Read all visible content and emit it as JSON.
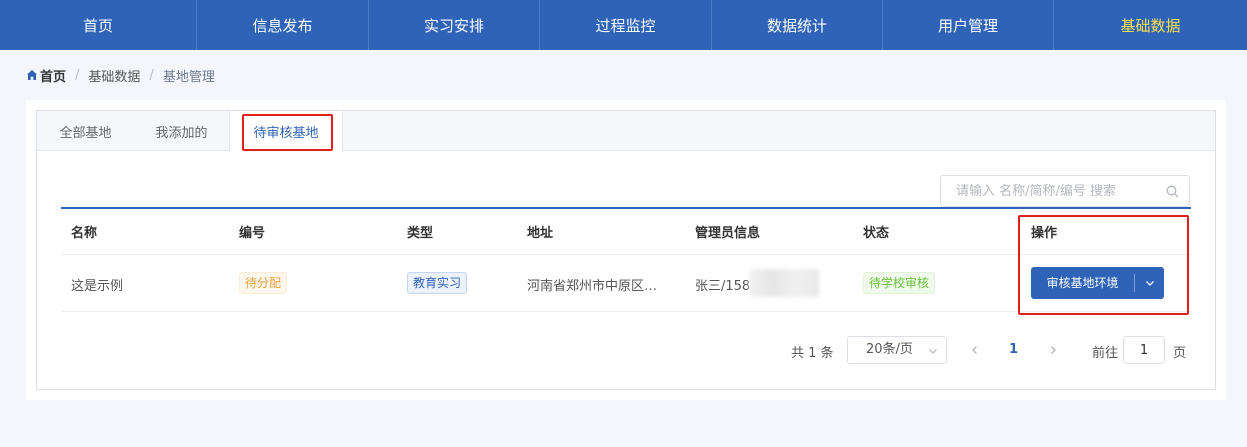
{
  "nav": {
    "items": [
      "首页",
      "信息发布",
      "实习安排",
      "过程监控",
      "数据统计",
      "用户管理",
      "基础数据"
    ],
    "active_index": 6
  },
  "breadcrumb": {
    "home": "首页",
    "middle": "基础数据",
    "current": "基地管理"
  },
  "tabs": {
    "items": [
      "全部基地",
      "我添加的",
      "待审核基地"
    ],
    "active_index": 2
  },
  "search": {
    "placeholder": "请输入 名称/简称/编号 搜索",
    "value": ""
  },
  "table": {
    "headers": [
      "名称",
      "编号",
      "类型",
      "地址",
      "管理员信息",
      "状态",
      "操作"
    ],
    "rows": [
      {
        "name": "这是示例",
        "code": "待分配",
        "type": "教育实习",
        "address": "河南省郑州市中原区…",
        "admin": "张三/158",
        "status": "待学校审核",
        "action": "审核基地环境"
      }
    ]
  },
  "pagination": {
    "total": "共 1 条",
    "page_size": "20条/页",
    "current_page": "1",
    "goto_label": "前往",
    "goto_value": "1",
    "page_suffix": "页"
  },
  "colors": {
    "primary": "#2f63b7",
    "nav_active": "#ffe14d",
    "highlight": "#e02020"
  }
}
